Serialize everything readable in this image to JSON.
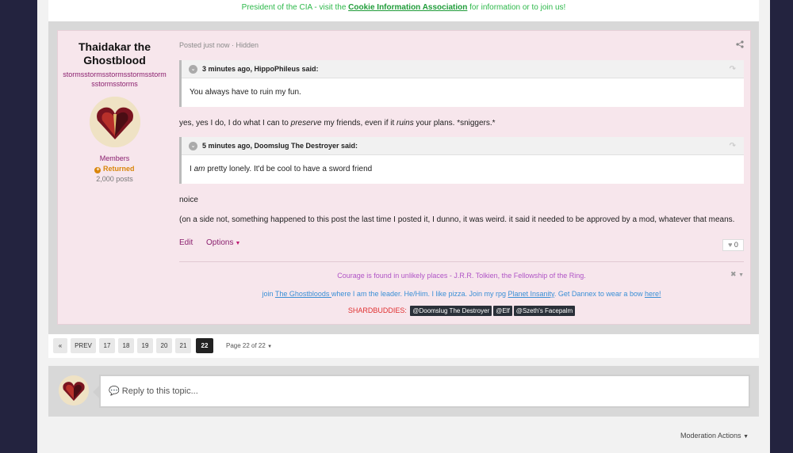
{
  "prev_signature": {
    "text_before": "President of the CIA - visit the ",
    "link": "Cookie Information Association",
    "text_after": " for information or to join us!"
  },
  "author": {
    "name": "Thaidakar the Ghostblood",
    "title": "stormsstormsstormsstormsstormsstormsstorms",
    "group": "Members",
    "badge": "Returned",
    "posts": "2,000 posts"
  },
  "post": {
    "meta": "Posted just now · Hidden",
    "quote1": {
      "header": "3 minutes ago, HippoPhileus said:",
      "body": "You always have to ruin my fun."
    },
    "reply1": {
      "p1": "yes, yes I do, I do what I can to ",
      "em1": "preserve",
      "p2": " my friends, even if it ",
      "em2": "ruins",
      "p3": " your plans. *sniggers.*"
    },
    "quote2": {
      "header": "5 minutes ago, Doomslug The Destroyer said:",
      "b1": "I ",
      "em": "am",
      "b2": " pretty lonely. It'd be cool to have a sword friend"
    },
    "line_noice": "noice",
    "line_side": "(on a side not, something happened to this post the last time I posted it, I dunno, it was weird. it said it needed to be approved by a mod, whatever that means.",
    "edit_label": "Edit",
    "options_label": "Options",
    "reaction_count": "0"
  },
  "signature": {
    "line1": "Courage is found in unlikely places - J.R.R. Tolkien, the Fellowship of the Ring.",
    "line2": {
      "t1": "join ",
      "l1": " The Ghostbloods ",
      "t2": " where I am the leader. He/Him. I like pizza. Join my rpg ",
      "l2": "Planet Insanity",
      "t3": ". Get Dannex to wear a bow ",
      "l3": "here!"
    },
    "line3_label": "SHARDBUDDIES:",
    "chips": [
      "@Doomslug The Destroyer",
      "@Elf",
      "@Szeth's Facepalm"
    ]
  },
  "pagination": {
    "prev": "PREV",
    "pages": [
      "17",
      "18",
      "19",
      "20",
      "21",
      "22"
    ],
    "active": "22",
    "info": "Page 22 of 22"
  },
  "reply": {
    "placeholder": "Reply to this topic..."
  },
  "moderation": "Moderation Actions",
  "colors": {
    "accent": "#8a1f6e",
    "post_bg": "#f7e6ec",
    "page_bg": "#23233f"
  }
}
